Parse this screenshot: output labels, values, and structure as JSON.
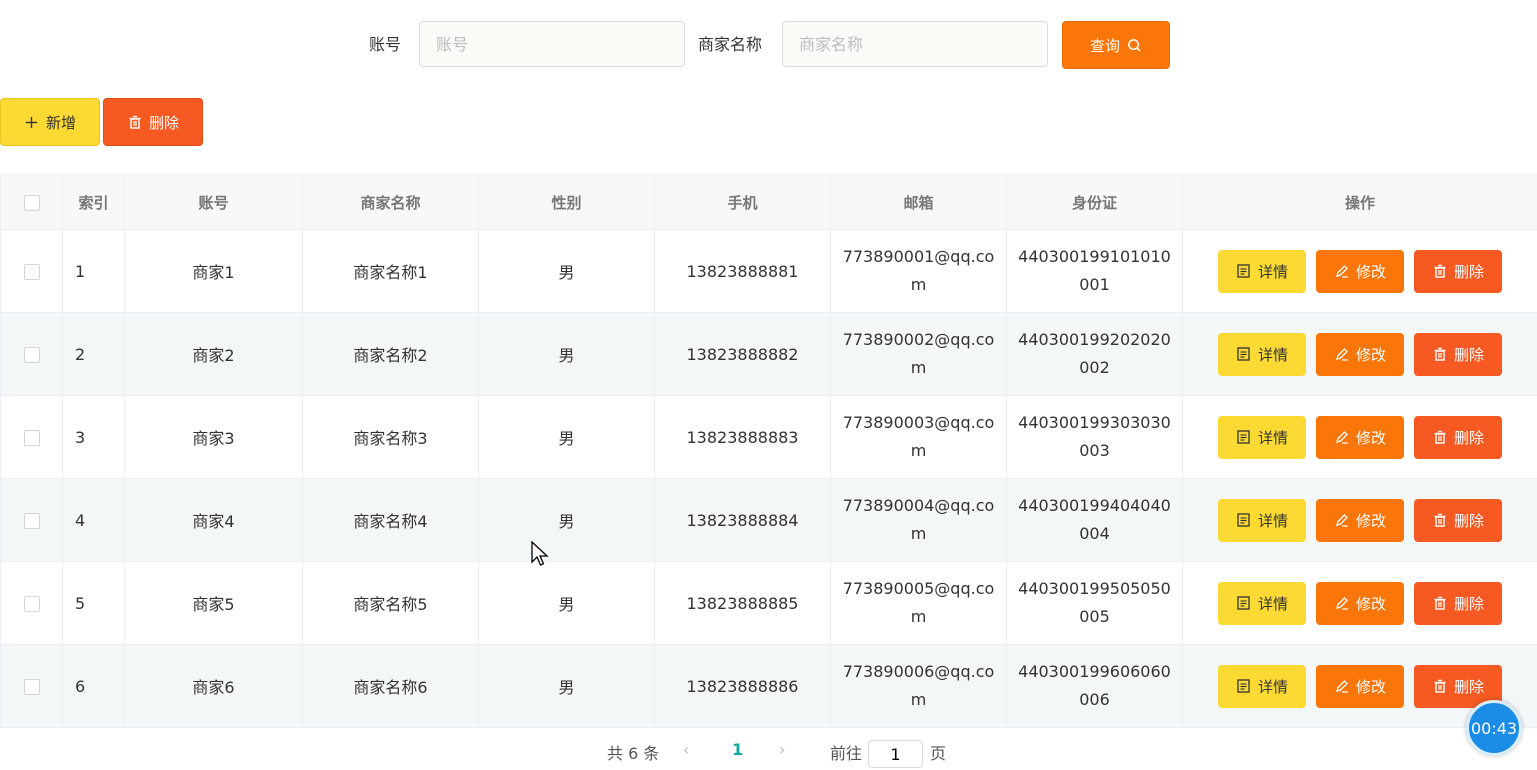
{
  "search": {
    "account_label": "账号",
    "account_placeholder": "账号",
    "account_value": "",
    "merchant_label": "商家名称",
    "merchant_placeholder": "商家名称",
    "merchant_value": "",
    "query_button": "查询",
    "query_icon": "search-icon"
  },
  "toolbar": {
    "add_button": "新增",
    "add_icon": "plus-icon",
    "delete_button": "删除",
    "delete_icon": "trash-icon"
  },
  "table": {
    "headers": [
      "索引",
      "账号",
      "商家名称",
      "性别",
      "手机",
      "邮箱",
      "身份证",
      "操作"
    ],
    "row_actions": {
      "detail": "详情",
      "detail_icon": "document-icon",
      "edit": "修改",
      "edit_icon": "pencil-icon",
      "delete": "删除",
      "delete_icon": "trash-icon"
    },
    "rows": [
      {
        "index": "1",
        "account": "商家1",
        "name": "商家名称1",
        "gender": "男",
        "phone": "13823888881",
        "email": "773890001@qq.com",
        "id_card": "440300199101010001"
      },
      {
        "index": "2",
        "account": "商家2",
        "name": "商家名称2",
        "gender": "男",
        "phone": "13823888882",
        "email": "773890002@qq.com",
        "id_card": "440300199202020002"
      },
      {
        "index": "3",
        "account": "商家3",
        "name": "商家名称3",
        "gender": "男",
        "phone": "13823888883",
        "email": "773890003@qq.com",
        "id_card": "440300199303030003"
      },
      {
        "index": "4",
        "account": "商家4",
        "name": "商家名称4",
        "gender": "男",
        "phone": "13823888884",
        "email": "773890004@qq.com",
        "id_card": "440300199404040004"
      },
      {
        "index": "5",
        "account": "商家5",
        "name": "商家名称5",
        "gender": "男",
        "phone": "13823888885",
        "email": "773890005@qq.com",
        "id_card": "440300199505050005"
      },
      {
        "index": "6",
        "account": "商家6",
        "name": "商家名称6",
        "gender": "男",
        "phone": "13823888886",
        "email": "773890006@qq.com",
        "id_card": "440300199606060006"
      }
    ]
  },
  "pagination": {
    "total": "共 6 条",
    "prev": "‹",
    "current": "1",
    "next": "›",
    "goto_label": "前往",
    "goto_value": "1",
    "page_suffix": "页"
  },
  "timer": "00:43",
  "colors": {
    "primary_yellow": "#fcd933",
    "primary_orange": "#fb7608",
    "danger_orange": "#f65a22",
    "page_active": "#13a89e",
    "timer_blue": "#1a8ce6"
  }
}
